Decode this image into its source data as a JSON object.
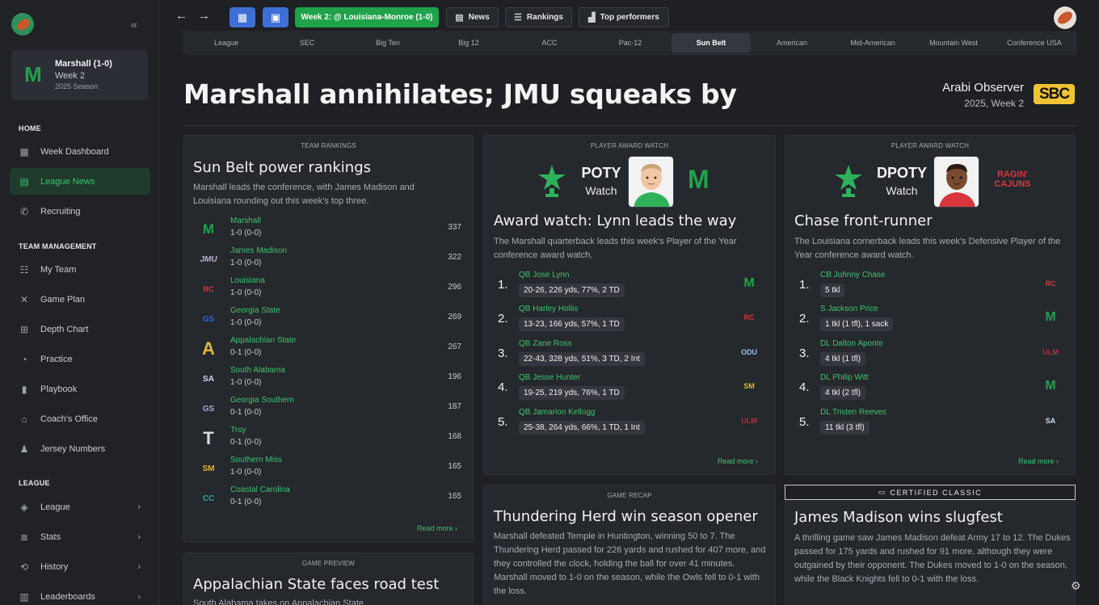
{
  "sidebar": {
    "team_card": {
      "name": "Marshall (1-0)",
      "week": "Week 2",
      "season": "2025 Season"
    },
    "sections": {
      "home": "HOME",
      "team_management": "TEAM MANAGEMENT",
      "league": "LEAGUE"
    },
    "items": [
      {
        "label": "Week Dashboard",
        "icon": "dashboard-icon"
      },
      {
        "label": "League News",
        "icon": "newspaper-icon",
        "active": true
      },
      {
        "label": "Recruiting",
        "icon": "phone-icon"
      },
      {
        "label": "My Team",
        "icon": "team-icon"
      },
      {
        "label": "Game Plan",
        "icon": "game-plan-icon"
      },
      {
        "label": "Depth Chart",
        "icon": "depth-chart-icon"
      },
      {
        "label": "Practice",
        "icon": "whistle-icon"
      },
      {
        "label": "Playbook",
        "icon": "book-icon"
      },
      {
        "label": "Coach's Office",
        "icon": "office-icon"
      },
      {
        "label": "Jersey Numbers",
        "icon": "jersey-icon"
      },
      {
        "label": "League",
        "icon": "league-icon"
      },
      {
        "label": "Stats",
        "icon": "stats-icon"
      },
      {
        "label": "History",
        "icon": "history-icon"
      },
      {
        "label": "Leaderboards",
        "icon": "leaderboard-icon"
      }
    ]
  },
  "topbar": {
    "week_button": "Week 2: @ Louisiana-Monroe (1-0)",
    "news": "News",
    "rankings": "Rankings",
    "top_performers": "Top performers"
  },
  "conference_tabs": [
    "League",
    "SEC",
    "Big Ten",
    "Big 12",
    "ACC",
    "Pac-12",
    "Sun Belt",
    "American",
    "Mid-American",
    "Mountain West",
    "Conference USA"
  ],
  "active_conference": "Sun Belt",
  "headline": "Marshall annihilates; JMU squeaks by",
  "paper": {
    "name": "Arabi Observer",
    "date": "2025, Week 2",
    "logo_text": "SBC"
  },
  "rankings_card": {
    "caption": "TEAM RANKINGS",
    "title": "Sun Belt power rankings",
    "desc": "Marshall leads the conference, with James Madison and Louisiana rounding out this week's top three.",
    "rows": [
      {
        "team": "Marshall",
        "record": "1-0 (0-0)",
        "points": "337",
        "logo": "M"
      },
      {
        "team": "James Madison",
        "record": "1-0 (0-0)",
        "points": "322",
        "logo": "JMU"
      },
      {
        "team": "Louisiana",
        "record": "1-0 (0-0)",
        "points": "296",
        "logo": "RC"
      },
      {
        "team": "Georgia State",
        "record": "1-0 (0-0)",
        "points": "269",
        "logo": "GS"
      },
      {
        "team": "Appalachian State",
        "record": "0-1 (0-0)",
        "points": "267",
        "logo": "A"
      },
      {
        "team": "South Alabama",
        "record": "1-0 (0-0)",
        "points": "196",
        "logo": "SA"
      },
      {
        "team": "Georgia Southern",
        "record": "0-1 (0-0)",
        "points": "187",
        "logo": "GS"
      },
      {
        "team": "Troy",
        "record": "0-1 (0-0)",
        "points": "168",
        "logo": "T"
      },
      {
        "team": "Southern Miss",
        "record": "1-0 (0-0)",
        "points": "165",
        "logo": "SM"
      },
      {
        "team": "Coastal Carolina",
        "record": "0-1 (0-0)",
        "points": "165",
        "logo": "CC"
      }
    ],
    "read_more": "Read more"
  },
  "poty_card": {
    "caption": "PLAYER AWARD WATCH",
    "award": "POTY",
    "watch": "Watch",
    "title": "Award watch: Lynn leads the way",
    "desc": "The Marshall quarterback leads this week's Player of the Year conference award watch.",
    "rows": [
      {
        "num": "1.",
        "name": "QB Jose Lynn",
        "stat": "20-26, 226 yds, 77%, 2 TD",
        "logo": "M"
      },
      {
        "num": "2.",
        "name": "QB Harley Hollis",
        "stat": "13-23, 166 yds, 57%, 1 TD",
        "logo": "RC"
      },
      {
        "num": "3.",
        "name": "QB Zane Ross",
        "stat": "22-43, 328 yds, 51%, 3 TD, 2 Int",
        "logo": "ODU"
      },
      {
        "num": "4.",
        "name": "QB Jesse Hunter",
        "stat": "19-25, 219 yds, 76%, 1 TD",
        "logo": "SM"
      },
      {
        "num": "5.",
        "name": "QB Jamarion Kellogg",
        "stat": "25-38, 264 yds, 66%, 1 TD, 1 Int",
        "logo": "ULM"
      }
    ],
    "read_more": "Read more"
  },
  "dpoty_card": {
    "caption": "PLAYER AWARD WATCH",
    "award": "DPOTY",
    "watch": "Watch",
    "title": "Chase front-runner",
    "desc": "The Louisiana cornerback leads this week's Defensive Player of the Year conference award watch.",
    "rows": [
      {
        "num": "1.",
        "name": "CB Johnny Chase",
        "stat": "5 tkl",
        "logo": "RC"
      },
      {
        "num": "2.",
        "name": "S Jackson Price",
        "stat": "1 tkl (1 tfl), 1 sack",
        "logo": "M"
      },
      {
        "num": "3.",
        "name": "DL Dalton Aponte",
        "stat": "4 tkl (1 tfl)",
        "logo": "ULM"
      },
      {
        "num": "4.",
        "name": "DL Philip Witt",
        "stat": "4 tkl (2 tfl)",
        "logo": "M"
      },
      {
        "num": "5.",
        "name": "DL Tristen Reeves",
        "stat": "11 tkl (3 tfl)",
        "logo": "SA"
      }
    ],
    "read_more": "Read more"
  },
  "recap_card": {
    "caption": "GAME RECAP",
    "title": "Thundering Herd win season opener",
    "desc": "Marshall defeated Temple in Huntington, winning 50 to 7. The Thundering Herd passed for 226 yards and rushed for 407 more, and they controlled the clock, holding the ball for over 41 minutes. Marshall moved to 1-0 on the season, while the Owls fell to 0-1 with the loss."
  },
  "classic_card": {
    "badge": "CERTIFIED CLASSIC",
    "title": "James Madison wins slugfest",
    "desc": "A thrilling game saw James Madison defeat Army 17 to 12. The Dukes passed for 175 yards and rushed for 91 more, although they were outgained by their opponent. The Dukes moved to 1-0 on the season, while the Black Knights fell to 0-1 with the loss."
  },
  "preview_card": {
    "caption": "GAME PREVIEW",
    "title": "Appalachian State faces road test",
    "desc": "South Alabama takes on Appalachian State"
  },
  "colors": {
    "accent_green": "#1fa24a",
    "accent_blue": "#3e6fd6",
    "background": "#1e2024",
    "card": "#25282d"
  }
}
